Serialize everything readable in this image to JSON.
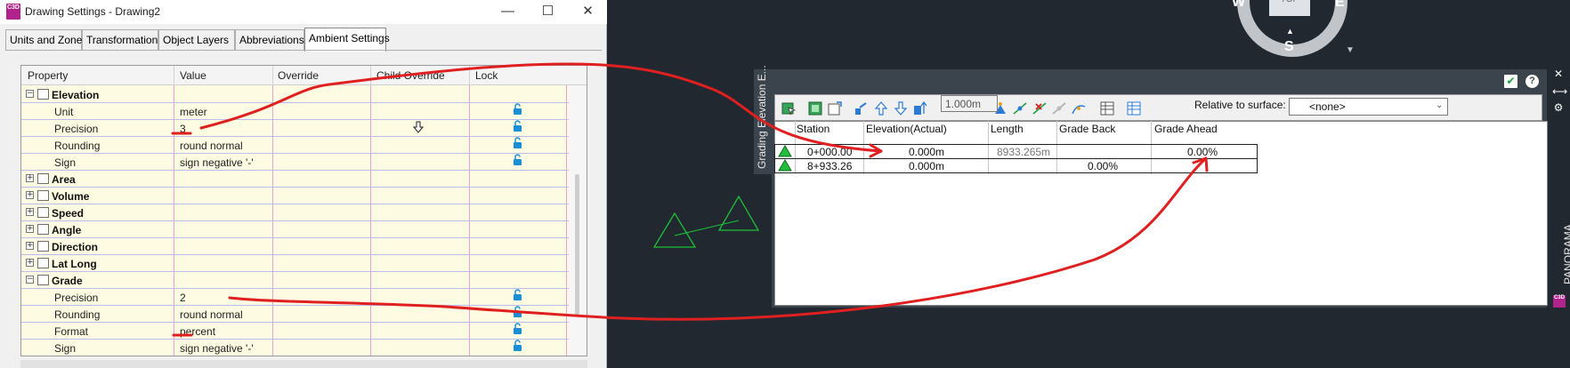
{
  "dialog": {
    "title": "Drawing Settings - Drawing2",
    "app_icon_text": "C3D",
    "window_controls": {
      "minimize": "—",
      "maximize": "☐",
      "close": "✕"
    },
    "tabs": [
      "Units and Zone",
      "Transformation",
      "Object Layers",
      "Abbreviations",
      "Ambient Settings"
    ],
    "active_tab": "Ambient Settings",
    "grid": {
      "columns": [
        "Property",
        "Value",
        "Override",
        "Child Override",
        "Lock"
      ],
      "elevation": {
        "label": "Elevation",
        "rows": [
          {
            "name": "Unit",
            "value": "meter"
          },
          {
            "name": "Precision",
            "value": "3"
          },
          {
            "name": "Rounding",
            "value": "round normal"
          },
          {
            "name": "Sign",
            "value": "sign negative '-'"
          }
        ]
      },
      "collapsed": [
        "Area",
        "Volume",
        "Speed",
        "Angle",
        "Direction",
        "Lat Long"
      ],
      "grade": {
        "label": "Grade",
        "rows": [
          {
            "name": "Precision",
            "value": "2"
          },
          {
            "name": "Rounding",
            "value": "round normal"
          },
          {
            "name": "Format",
            "value": "percent"
          },
          {
            "name": "Sign",
            "value": "sign negative '-'"
          }
        ]
      },
      "expand_glyph": "+",
      "collapse_glyph": "−"
    }
  },
  "palette": {
    "strip_title": "Grading Elevation E...",
    "elevation_value": "1.000m",
    "relative_label": "Relative to surface:",
    "relative_value": "<none>",
    "columns": [
      "Station",
      "Elevation(Actual)",
      "Length",
      "Grade Back",
      "Grade Ahead"
    ],
    "rows": [
      {
        "station": "0+000.00",
        "elevation": "0.000m",
        "length": "8933.265m",
        "grade_back": "",
        "grade_ahead": "0.00%"
      },
      {
        "station": "8+933.26",
        "elevation": "0.000m",
        "length": "",
        "grade_back": "0.00%",
        "grade_ahead": ""
      }
    ],
    "side_icons": {
      "close": "✕",
      "autohide": "⟷",
      "props": "⚙"
    },
    "panorama_label": "PANORAMA",
    "panorama_icon_text": "C3D",
    "apply_icon": "✔",
    "help_icon": "?"
  },
  "viewcube": {
    "top": "TOP",
    "south": "S",
    "west": "W",
    "east": "E"
  },
  "colors": {
    "accent": "#b0228c",
    "annotation": "#e02020",
    "triangle": "#1fbf3a",
    "lock": "#1a8fd6",
    "background": "#212830"
  }
}
